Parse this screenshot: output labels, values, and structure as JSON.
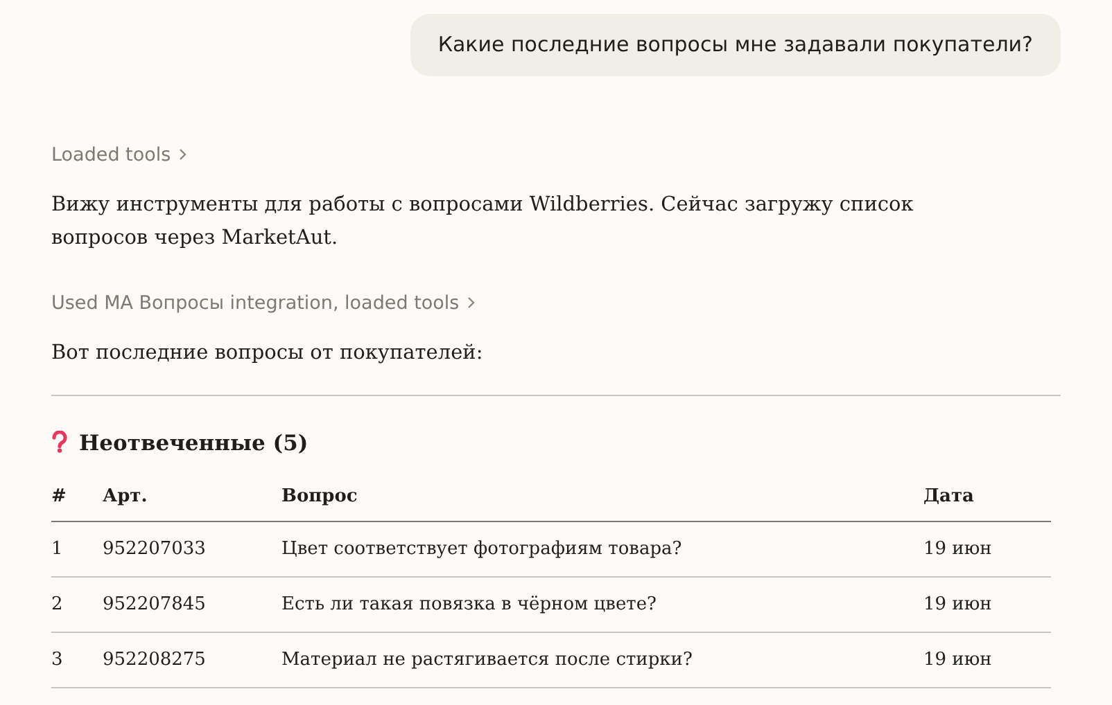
{
  "user_message": "Какие последние вопросы мне задавали покупатели?",
  "response": [
    {
      "kind": "tool",
      "label": "Loaded tools"
    },
    {
      "kind": "text",
      "text": "Вижу инструменты для работы с вопросами Wildberries. Сейчас загружу список вопросов через MarketAut."
    },
    {
      "kind": "tool",
      "label": "Used MA Вопросы integration, loaded tools"
    },
    {
      "kind": "text",
      "text": "Вот последние вопросы от покупателей:"
    }
  ],
  "section": {
    "title": "Неотвеченные (5)"
  },
  "table": {
    "columns": [
      "#",
      "Арт.",
      "Вопрос",
      "Дата"
    ],
    "rows": [
      [
        "1",
        "952207033",
        "Цвет соответствует фотографиям товара?",
        "19 июн"
      ],
      [
        "2",
        "952207845",
        "Есть ли такая повязка в чёрном цвете?",
        "19 июн"
      ],
      [
        "3",
        "952208275",
        "Материал не растягивается после стирки?",
        "19 июн"
      ]
    ]
  }
}
